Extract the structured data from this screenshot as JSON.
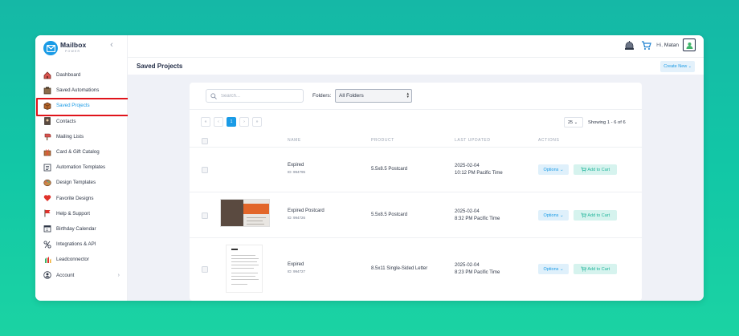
{
  "brand": {
    "name": "Mailbox",
    "sub": "POWER"
  },
  "sidebar": {
    "items": [
      {
        "label": "Dashboard",
        "icon": "home-icon"
      },
      {
        "label": "Saved Automations",
        "icon": "automation-icon"
      },
      {
        "label": "Saved Projects",
        "icon": "box-icon",
        "active": true
      },
      {
        "label": "Contacts",
        "icon": "contacts-icon"
      },
      {
        "label": "Mailing Lists",
        "icon": "mailbox-icon"
      },
      {
        "label": "Card & Gift Catalog",
        "icon": "gift-icon"
      },
      {
        "label": "Automation Templates",
        "icon": "template-icon"
      },
      {
        "label": "Design Templates",
        "icon": "palette-icon"
      },
      {
        "label": "Favorite Designs",
        "icon": "heart-icon"
      },
      {
        "label": "Help & Support",
        "icon": "flag-icon"
      },
      {
        "label": "Birthday Calendar",
        "icon": "calendar-icon"
      },
      {
        "label": "Integrations & API",
        "icon": "integrations-icon"
      },
      {
        "label": "Leadconnector",
        "icon": "leadconnector-icon"
      },
      {
        "label": "Account",
        "icon": "account-icon"
      }
    ]
  },
  "header": {
    "greeting": "Hi,",
    "user": "Matan"
  },
  "page": {
    "title": "Saved Projects",
    "create_new": "Create New"
  },
  "search": {
    "placeholder": "Search..."
  },
  "folders": {
    "label": "Folders:",
    "selected": "All Folders"
  },
  "pagination": {
    "first": "«",
    "prev": "‹",
    "current": "1",
    "next": "›",
    "last": "»",
    "per_page": "25",
    "showing": "Showing 1 - 6 of 6"
  },
  "table": {
    "columns": {
      "name": "NAME",
      "product": "PRODUCT",
      "last_updated": "LAST UPDATED",
      "actions": "ACTIONS"
    },
    "options_label": "Options",
    "cart_label": "Add to Cart",
    "rows": [
      {
        "name": "Expired",
        "id": "ID: 994795",
        "product": "5.5x8.5 Postcard",
        "date": "2025-02-04",
        "time": "10:12 PM Pacific Time",
        "thumb": "none"
      },
      {
        "name": "Expired Postcard",
        "id": "ID: 994726",
        "product": "5.5x8.5 Postcard",
        "date": "2025-02-04",
        "time": "8:32 PM Pacific Time",
        "thumb": "postcard"
      },
      {
        "name": "Expired",
        "id": "ID: 994727",
        "product": "8.5x11 Single-Sided Letter",
        "date": "2025-02-04",
        "time": "8:23 PM Pacific Time",
        "thumb": "letter"
      }
    ]
  },
  "colors": {
    "accent": "#1a9be6",
    "cart": "#21b59b",
    "highlight": "#e0141b"
  }
}
